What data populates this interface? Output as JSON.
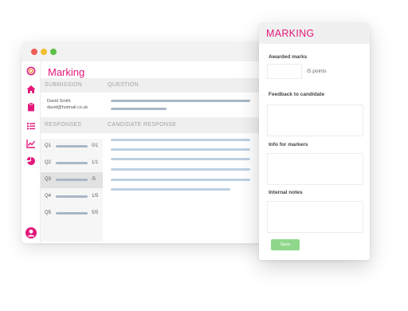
{
  "app": {
    "page_title": "Marking",
    "headers": {
      "submission": "SUBMISSION",
      "question": "QUESTION",
      "responses": "RESPONSES",
      "candidate_response": "CANDIDATE RESPONSE"
    },
    "submission": {
      "name": "David Smith",
      "email": "david@hotmail.co.uk"
    },
    "responses": [
      {
        "question": "Q1",
        "score": "0/1",
        "selected": false
      },
      {
        "question": "Q2",
        "score": "1/1",
        "selected": false
      },
      {
        "question": "Q3",
        "score": "/5",
        "selected": true
      },
      {
        "question": "Q4",
        "score": "1/5",
        "selected": false
      },
      {
        "question": "Q5",
        "score": "5/5",
        "selected": false
      }
    ],
    "sidebar_icons": [
      "logo-icon",
      "home-icon",
      "clipboard-icon",
      "list-icon",
      "chart-icon",
      "pie-chart-icon",
      "user-avatar-icon"
    ],
    "accent_color": "#e3187b"
  },
  "panel": {
    "title": "MARKING",
    "awarded_marks_label": "Awarded marks",
    "awarded_marks_value": "",
    "points_suffix": "/5 points",
    "feedback_label": "Feedback to candidate",
    "feedback_value": "",
    "info_label": "Info for markers",
    "info_value": "",
    "notes_label": "Internal notes",
    "notes_value": "",
    "save_label": "Save",
    "save_color": "#8fd88b"
  }
}
